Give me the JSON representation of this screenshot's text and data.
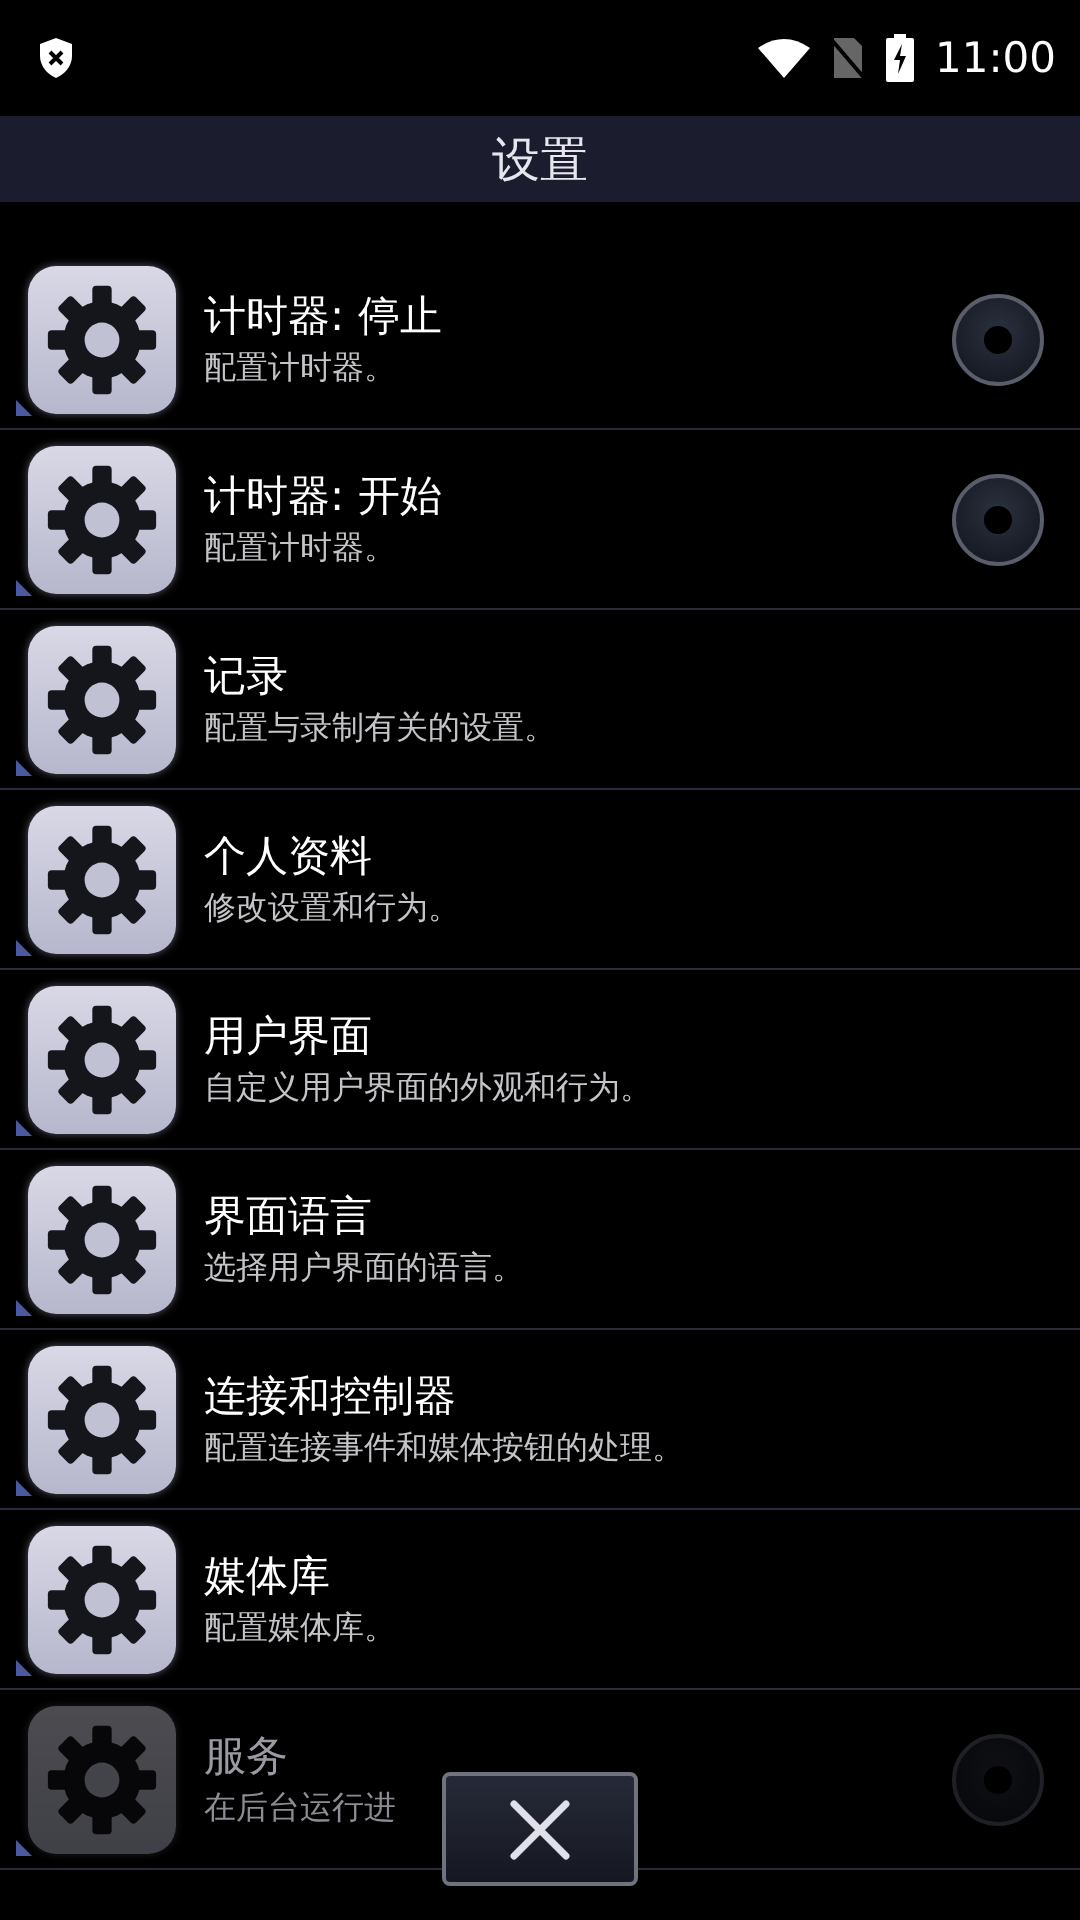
{
  "status_bar": {
    "time": "11:00"
  },
  "title": "设置",
  "items": [
    {
      "kind": "radio",
      "title": "计时器: 停止",
      "subtitle": "配置计时器。",
      "selected": false
    },
    {
      "kind": "radio",
      "title": "计时器: 开始",
      "subtitle": "配置计时器。",
      "selected": false
    },
    {
      "kind": "plain",
      "title": "记录",
      "subtitle": "配置与录制有关的设置。"
    },
    {
      "kind": "plain",
      "title": "个人资料",
      "subtitle": "修改设置和行为。"
    },
    {
      "kind": "plain",
      "title": "用户界面",
      "subtitle": "自定义用户界面的外观和行为。"
    },
    {
      "kind": "plain",
      "title": "界面语言",
      "subtitle": "选择用户界面的语言。"
    },
    {
      "kind": "plain",
      "title": "连接和控制器",
      "subtitle": "配置连接事件和媒体按钮的处理。"
    },
    {
      "kind": "plain",
      "title": "媒体库",
      "subtitle": "配置媒体库。"
    },
    {
      "kind": "radio",
      "title": "服务",
      "subtitle": "在后台运行进",
      "selected": false
    }
  ]
}
